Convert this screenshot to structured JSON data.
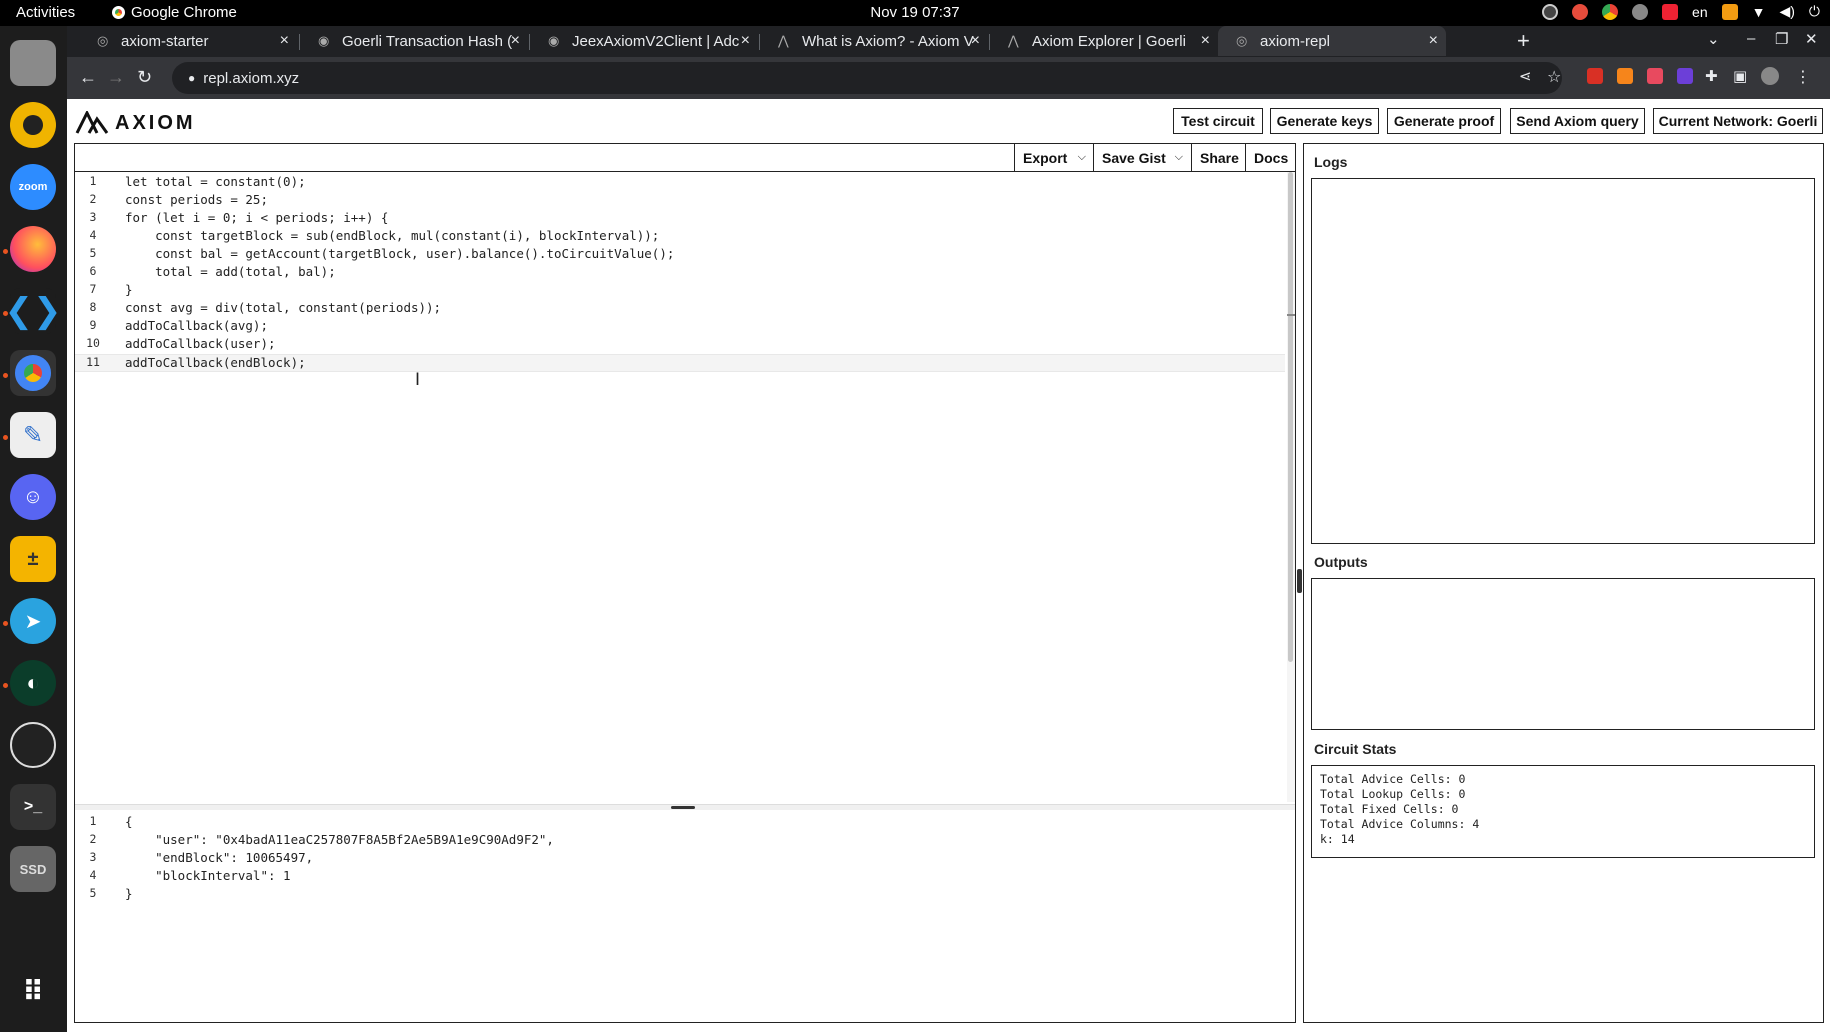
{
  "system_bar": {
    "activities": "Activities",
    "app_name": "Google Chrome",
    "clock": "Nov 19  07:37",
    "language": "en"
  },
  "browser": {
    "tabs": [
      {
        "title": "axiom-starter",
        "active": false
      },
      {
        "title": "Goerli Transaction Hash (",
        "active": false
      },
      {
        "title": "JeexAxiomV2Client | Adc",
        "active": false
      },
      {
        "title": "What is Axiom? - Axiom V",
        "active": false
      },
      {
        "title": "Axiom Explorer | Goerli",
        "active": false
      },
      {
        "title": "axiom-repl",
        "active": true
      }
    ],
    "url": "repl.axiom.xyz"
  },
  "app": {
    "logo_text": "AXIOM",
    "header_buttons": {
      "test_circuit": "Test circuit",
      "generate_keys": "Generate keys",
      "generate_proof": "Generate proof",
      "send_query": "Send Axiom query",
      "network": "Current Network: Goerli"
    },
    "editor_toolbar": {
      "export": "Export",
      "save_gist": "Save Gist",
      "share": "Share",
      "docs": "Docs"
    },
    "code_lines": [
      "let total = constant(0);",
      "const periods = 25;",
      "for (let i = 0; i < periods; i++) {",
      "    const targetBlock = sub(endBlock, mul(constant(i), blockInterval));",
      "    const bal = getAccount(targetBlock, user).balance().toCircuitValue();",
      "    total = add(total, bal);",
      "}",
      "const avg = div(total, constant(periods));",
      "addToCallback(avg);",
      "addToCallback(user);",
      "addToCallback(endBlock);"
    ],
    "input_lines": [
      "{",
      "    \"user\": \"0x4badA11eaC257807F8A5Bf2Ae5B9A1e9C90Ad9F2\",",
      "    \"endBlock\": 10065497,",
      "    \"blockInterval\": 1",
      "}"
    ],
    "panels": {
      "logs_title": "Logs",
      "outputs_title": "Outputs",
      "stats_title": "Circuit Stats"
    },
    "circuit_stats": [
      "Total Advice Cells: 0",
      "Total Lookup Cells: 0",
      "Total Fixed Cells: 0",
      "Total Advice Columns: 4",
      "k: 14"
    ]
  },
  "dock": {
    "zoom_label": "zoom",
    "ssd_label": "SSD"
  }
}
